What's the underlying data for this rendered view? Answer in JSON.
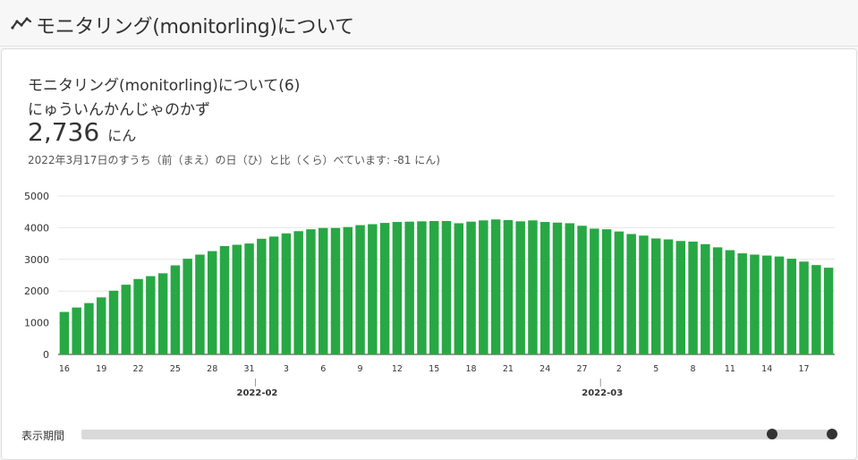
{
  "header": {
    "title": "モニタリング(monitorling)について",
    "icon": "trend-line-icon"
  },
  "card": {
    "title": "モニタリング(monitorling)について(6)",
    "subtitle": "にゅういんかんじゃのかず",
    "value": "2,736",
    "unit": "にん",
    "comparison": "2022年3月17日のすうち（前（まえ）の日（ひ）と比（くら）べています: -81 にん)"
  },
  "range": {
    "label": "表示期間"
  },
  "colors": {
    "bar": "#27a844",
    "axis": "#333333",
    "grid": "#e6e6e6"
  },
  "chart_data": {
    "type": "bar",
    "ylim": [
      0,
      5000
    ],
    "y_ticks": [
      "0",
      "1000",
      "2000",
      "3000",
      "4000",
      "5000"
    ],
    "x_ticks": [
      "16",
      "19",
      "22",
      "25",
      "28",
      "31",
      "3",
      "6",
      "9",
      "12",
      "15",
      "18",
      "21",
      "24",
      "27",
      "2",
      "5",
      "8",
      "11",
      "14",
      "17"
    ],
    "month_labels": [
      "2022-02",
      "2022-03"
    ],
    "values": [
      1340,
      1480,
      1620,
      1800,
      2010,
      2200,
      2380,
      2470,
      2560,
      2810,
      3020,
      3150,
      3260,
      3420,
      3460,
      3500,
      3650,
      3720,
      3820,
      3890,
      3950,
      3990,
      3990,
      4020,
      4080,
      4110,
      4150,
      4180,
      4190,
      4200,
      4210,
      4210,
      4140,
      4190,
      4230,
      4260,
      4240,
      4200,
      4230,
      4180,
      4160,
      4140,
      4060,
      3970,
      3950,
      3880,
      3800,
      3750,
      3660,
      3630,
      3580,
      3560,
      3480,
      3380,
      3290,
      3190,
      3150,
      3120,
      3090,
      3020,
      2930,
      2820,
      2736
    ]
  }
}
